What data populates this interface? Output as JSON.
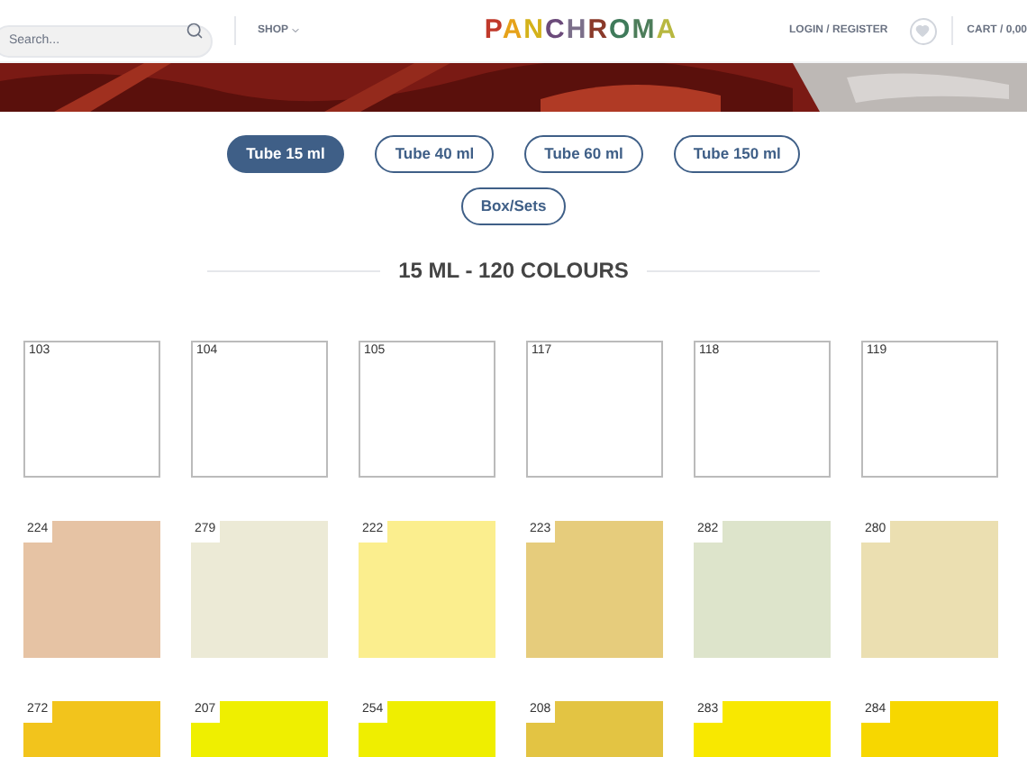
{
  "header": {
    "search": {
      "placeholder": "Search..."
    },
    "shop_menu": "SHOP",
    "logo": "PANCHROMA",
    "login": "LOGIN / REGISTER",
    "cart": "CART / 0,00"
  },
  "tabs": [
    {
      "label": "Tube 15 ml",
      "selected": true
    },
    {
      "label": "Tube 40 ml",
      "selected": false
    },
    {
      "label": "Tube 60 ml",
      "selected": false
    },
    {
      "label": "Tube 150 ml",
      "selected": false
    },
    {
      "label": "Box/Sets",
      "selected": false
    }
  ],
  "section_title": "15 ML - 120 COLOURS",
  "swatches": [
    {
      "code": "103",
      "kind": "white",
      "color": "#ffffff"
    },
    {
      "code": "104",
      "kind": "white",
      "color": "#ffffff"
    },
    {
      "code": "105",
      "kind": "white",
      "color": "#ffffff"
    },
    {
      "code": "117",
      "kind": "white",
      "color": "#ffffff"
    },
    {
      "code": "118",
      "kind": "white",
      "color": "#ffffff"
    },
    {
      "code": "119",
      "kind": "white",
      "color": "#ffffff"
    },
    {
      "code": "224",
      "kind": "filled",
      "color": "#e6c3a4"
    },
    {
      "code": "279",
      "kind": "filled",
      "color": "#ecead6"
    },
    {
      "code": "222",
      "kind": "filled",
      "color": "#fbee8e"
    },
    {
      "code": "223",
      "kind": "filled",
      "color": "#e6cc7c"
    },
    {
      "code": "282",
      "kind": "filled",
      "color": "#dde4cb"
    },
    {
      "code": "280",
      "kind": "filled",
      "color": "#ebdfb1"
    },
    {
      "code": "272",
      "kind": "filled",
      "color": "#f2c41c"
    },
    {
      "code": "207",
      "kind": "filled",
      "color": "#efef00"
    },
    {
      "code": "254",
      "kind": "filled",
      "color": "#efee00"
    },
    {
      "code": "208",
      "kind": "filled",
      "color": "#e3c443"
    },
    {
      "code": "283",
      "kind": "filled",
      "color": "#f8e800"
    },
    {
      "code": "284",
      "kind": "filled",
      "color": "#f7d700"
    }
  ]
}
